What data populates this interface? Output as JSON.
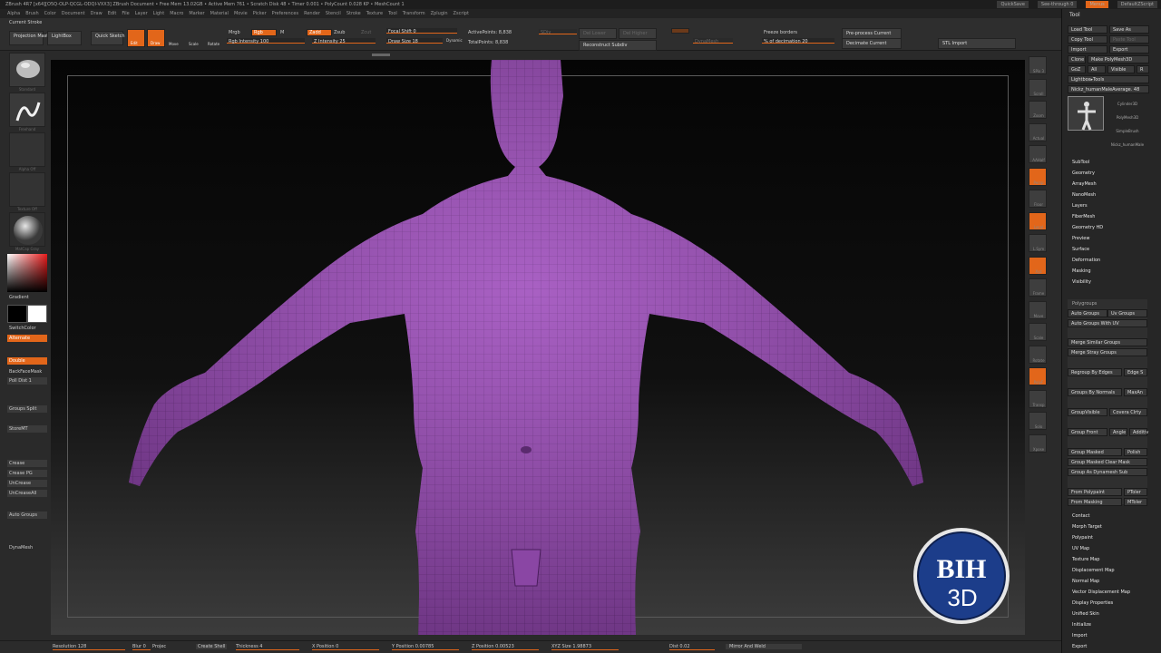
{
  "titlebar": {
    "title": "ZBrush 4R7 [x64][O5Q-OLP-QCGL-ODQI-VXX3]   ZBrush Document   • Free Mem 13.02GB • Active Mem 761 • Scratch Disk 48 • Timer 0.001 • PolyCount 0.028 KP • MeshCount 1",
    "quicksave": "QuickSave",
    "seethrough": "See-through 0",
    "menus_btn": "Menus",
    "script_btn": "DefaultZScript"
  },
  "menubar": [
    "Alpha",
    "Brush",
    "Color",
    "Document",
    "Draw",
    "Edit",
    "File",
    "Layer",
    "Light",
    "Macro",
    "Marker",
    "Material",
    "Movie",
    "Picker",
    "Preferences",
    "Render",
    "Stencil",
    "Stroke",
    "Texture",
    "Tool",
    "Transform",
    "Zplugin",
    "Zscript"
  ],
  "shelf": {
    "current_stroke": "Current Stroke",
    "projection_master": "Projection Master",
    "lightbox": "LightBox",
    "quick_sketch": "Quick Sketch",
    "edit": "Edit",
    "draw": "Draw",
    "move": "Move",
    "scale": "Scale",
    "rotate": "Rotate",
    "mrgb": "Mrgb",
    "rgb": "Rgb",
    "m": "M",
    "rgb_intensity": "Rgb Intensity 100",
    "zadd": "Zadd",
    "zsub": "Zsub",
    "zcut": "Zcut",
    "z_intensity": "Z Intensity 25",
    "focal_shift": "Focal Shift 0",
    "draw_size": "Draw Size 18",
    "dynamic": "Dynamic",
    "active_points": "ActivePoints: 8,838",
    "total_points": "TotalPoints: 8,838",
    "sdiv_slider": "SDiv",
    "del_lower": "Del Lower",
    "del_higher": "Del Higher",
    "reconstruct_subdiv": "Reconstruct Subdiv",
    "dyn_subdiv": "DynaMesh",
    "freeze_borders": "Freeze borders",
    "decimation": "% of decimation 20",
    "preprocess_current": "Pre-process Current",
    "decimate_current": "Decimate Current",
    "stl_import": "STL Import"
  },
  "leftbar": {
    "brush_caption": "Standard",
    "stroke_caption": "Freehand",
    "alpha_caption": "Alpha Off",
    "texture_caption": "Texture Off",
    "material_caption": "MatCap Gray",
    "gradient": "Gradient",
    "switch_color": "SwitchColor",
    "alternate": "Alternate",
    "double": "Double",
    "backface_mask": "BackFaceMask",
    "poll_dist": "Poll Dist 1",
    "groups_split": "Groups Split",
    "store_mt": "StoreMT",
    "crease": "Crease",
    "crease_pg": "Crease PG",
    "uncrease": "UnCrease",
    "uncrease_all": "UnCreaseAll",
    "auto_groups": "Auto Groups",
    "dynamesh": "DynaMesh"
  },
  "right_icons": [
    "SPix 3",
    "Scroll",
    "Zoom",
    "Actual",
    "AAHalf",
    "Persp",
    "Floor",
    "Local",
    "L.Sym",
    "Xyz",
    "Frame",
    "Move",
    "Scale",
    "Rotate",
    "PolyF",
    "Transp",
    "Solo",
    "Xpose"
  ],
  "tool": {
    "header": "Tool",
    "load_tool": "Load Tool",
    "save_as": "Save As",
    "copy_tool": "Copy Tool",
    "paste_tool": "Paste Tool",
    "import": "Import",
    "export": "Export",
    "clone": "Clone",
    "make_polymesh": "Make PolyMesh3D",
    "goz": "GoZ",
    "all": "All",
    "visible": "Visible",
    "r": "R",
    "lightbox_tools": "Lightbox▸Tools",
    "current_tool": "Nickz_humanMaleAverage. 48",
    "thumbs": [
      "Cylinder3D",
      "PolyMesh3D",
      "SimpleBrush",
      "Nickz_humanMale"
    ],
    "sections_top": [
      "SubTool",
      "Geometry",
      "ArrayMesh",
      "NanoMesh",
      "Layers",
      "FiberMesh",
      "Geometry HD",
      "Preview",
      "Surface",
      "Deformation",
      "Masking",
      "Visibility"
    ],
    "polygroups_title": "Polygroups",
    "auto_groups": "Auto Groups",
    "uv_groups": "Uv Groups",
    "auto_groups_uv": "Auto Groups With UV",
    "merge_similar": "Merge Similar Groups",
    "merge_stray": "Merge Stray Groups",
    "regroup_edges": "Regroup By Edges",
    "edge_s": "Edge S",
    "groups_normals": "Groups By Normals",
    "max_an": "MaxAn",
    "group_visible": "GroupVisible",
    "coverage": "Covera Clrty",
    "group_front": "Group Front",
    "angle": "Angle",
    "additive": "Additiv",
    "group_masked": "Group Masked",
    "polish": "Polish",
    "group_masked_clear": "Group Masked Clear Mask",
    "group_as_dynamesh": "Group As Dynamesh Sub",
    "from_polypaint": "From Polypaint",
    "ptoler": "PToler",
    "from_masking": "From Masking",
    "mtoler": "MToler",
    "sections_bottom": [
      "Contact",
      "Morph Target",
      "Polypaint",
      "UV Map",
      "Texture Map",
      "Displacement Map",
      "Normal Map",
      "Vector Displacement Map",
      "Display Properties",
      "Unified Skin",
      "Initialize",
      "Import",
      "Export"
    ]
  },
  "bottombar": {
    "resolution": "Resolution 128",
    "blur": "Blur 0",
    "project": "Projec",
    "create_shell": "Create Shell",
    "thickness": "Thickness 4",
    "x_position": "X Position 0",
    "y_position": "Y Position 0.00785",
    "z_position": "Z Position 0.00523",
    "xyz_size": "XYZ Size 1.98873",
    "dist": "Dist 0.02",
    "mirror_weld": "Mirror And Weld"
  },
  "logo": {
    "line1": "BIH",
    "line2": "3D"
  },
  "colors": {
    "accent": "#e2661a",
    "mesh": "#9a4fb5",
    "logo_blue": "#1c3d8a"
  }
}
